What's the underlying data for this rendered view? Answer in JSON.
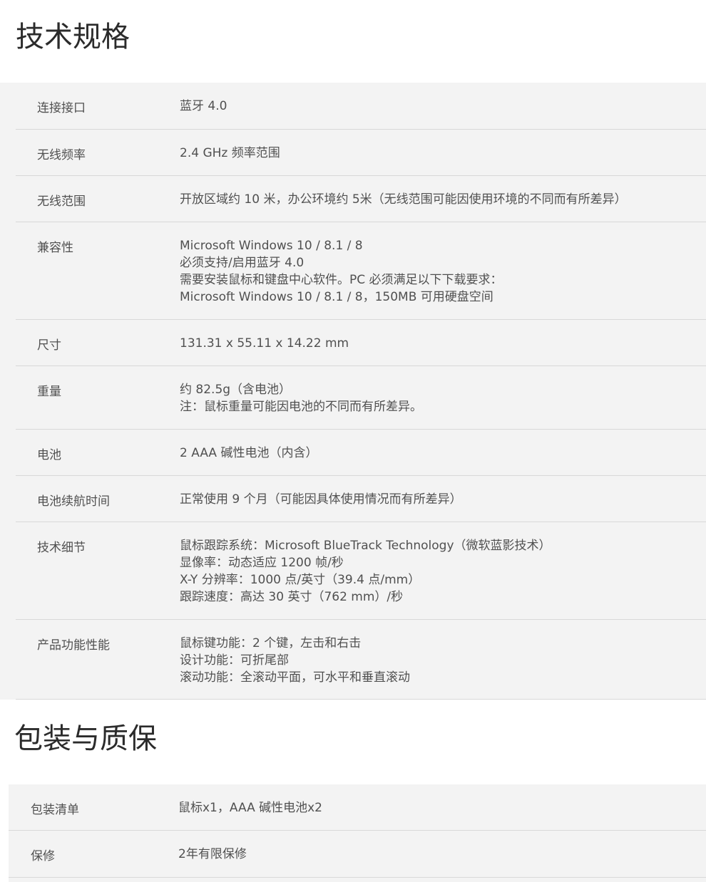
{
  "specs": {
    "title": "技术规格",
    "rows": [
      {
        "label": "连接接口",
        "lines": [
          "蓝牙 4.0"
        ]
      },
      {
        "label": "无线频率",
        "lines": [
          "2.4 GHz 频率范围"
        ]
      },
      {
        "label": "无线范围",
        "lines": [
          "开放区域约 10 米，办公环境约 5米（无线范围可能因使用环境的不同而有所差异）"
        ]
      },
      {
        "label": "兼容性",
        "lines": [
          "Microsoft Windows 10 / 8.1 / 8",
          "必须支持/启用蓝牙 4.0",
          "需要安装鼠标和键盘中心软件。PC 必须满足以下下载要求：",
          "Microsoft Windows 10 / 8.1 / 8，150MB 可用硬盘空间"
        ]
      },
      {
        "label": "尺寸",
        "lines": [
          "131.31 x 55.11 x 14.22 mm"
        ]
      },
      {
        "label": "重量",
        "lines": [
          "约 82.5g（含电池）",
          "注：鼠标重量可能因电池的不同而有所差异。"
        ]
      },
      {
        "label": "电池",
        "lines": [
          "2 AAA 碱性电池（内含）"
        ]
      },
      {
        "label": "电池续航时间",
        "lines": [
          "正常使用 9 个月（可能因具体使用情况而有所差异）"
        ]
      },
      {
        "label": "技术细节",
        "lines": [
          "鼠标跟踪系统：Microsoft BlueTrack Technology（微软蓝影技术）",
          "显像率：动态适应 1200 帧/秒",
          "X-Y 分辨率：1000 点/英寸（39.4 点/mm）",
          "跟踪速度：高达 30 英寸（762 mm）/秒"
        ]
      },
      {
        "label": "产品功能性能",
        "lines": [
          "鼠标键功能：2 个键，左击和右击",
          "设计功能：可折尾部",
          "滚动功能：全滚动平面，可水平和垂直滚动"
        ]
      }
    ]
  },
  "package": {
    "title": "包装与质保",
    "rows": [
      {
        "label": "包装清单",
        "lines": [
          "鼠标x1，AAA 碱性电池x2"
        ]
      },
      {
        "label": "保修",
        "lines": [
          "2年有限保修"
        ]
      }
    ]
  }
}
